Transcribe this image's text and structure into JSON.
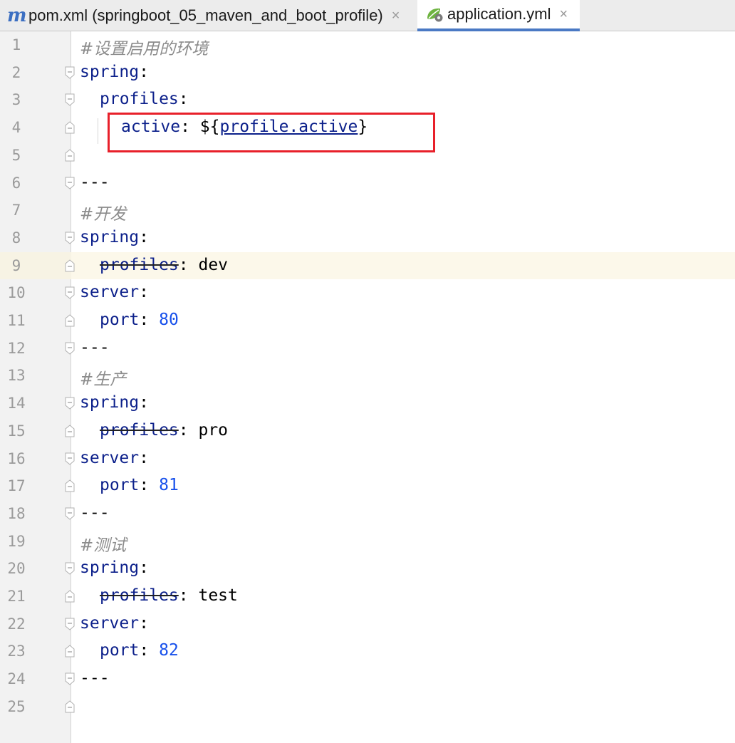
{
  "tabs": [
    {
      "label": "pom.xml (springboot_05_maven_and_boot_profile)",
      "icon": "maven-m-icon",
      "active": false
    },
    {
      "label": "application.yml",
      "icon": "spring-yml-icon",
      "active": true
    }
  ],
  "tab_close_glyph": "×",
  "editor": {
    "current_line": 9,
    "lines": [
      {
        "n": "1",
        "type": "comment",
        "indent": 0,
        "text": "#设置启用的环境"
      },
      {
        "n": "2",
        "type": "key",
        "indent": 0,
        "key": "spring",
        "colon": ":"
      },
      {
        "n": "3",
        "type": "key",
        "indent": 1,
        "key": "profiles",
        "colon": ":"
      },
      {
        "n": "4",
        "type": "ref",
        "indent": 2,
        "key": "active",
        "colon": ": ",
        "pre": "${",
        "ref": "profile.active",
        "post": "}"
      },
      {
        "n": "5",
        "type": "empty"
      },
      {
        "n": "6",
        "type": "sep",
        "text": "---"
      },
      {
        "n": "7",
        "type": "comment",
        "indent": 0,
        "text": "#开发"
      },
      {
        "n": "8",
        "type": "key",
        "indent": 0,
        "key": "spring",
        "colon": ":"
      },
      {
        "n": "9",
        "type": "dep",
        "indent": 1,
        "key": "profiles",
        "colon": ": ",
        "value": "dev"
      },
      {
        "n": "10",
        "type": "key",
        "indent": 0,
        "key": "server",
        "colon": ":"
      },
      {
        "n": "11",
        "type": "num",
        "indent": 1,
        "key": "port",
        "colon": ": ",
        "value": "80"
      },
      {
        "n": "12",
        "type": "sep",
        "text": "---"
      },
      {
        "n": "13",
        "type": "comment",
        "indent": 0,
        "text": "#生产"
      },
      {
        "n": "14",
        "type": "key",
        "indent": 0,
        "key": "spring",
        "colon": ":"
      },
      {
        "n": "15",
        "type": "dep",
        "indent": 1,
        "key": "profiles",
        "colon": ": ",
        "value": "pro"
      },
      {
        "n": "16",
        "type": "key",
        "indent": 0,
        "key": "server",
        "colon": ":"
      },
      {
        "n": "17",
        "type": "num",
        "indent": 1,
        "key": "port",
        "colon": ": ",
        "value": "81"
      },
      {
        "n": "18",
        "type": "sep",
        "text": "---"
      },
      {
        "n": "19",
        "type": "comment",
        "indent": 0,
        "text": "#测试"
      },
      {
        "n": "20",
        "type": "key",
        "indent": 0,
        "key": "spring",
        "colon": ":"
      },
      {
        "n": "21",
        "type": "dep",
        "indent": 1,
        "key": "profiles",
        "colon": ": ",
        "value": "test"
      },
      {
        "n": "22",
        "type": "key",
        "indent": 0,
        "key": "server",
        "colon": ":"
      },
      {
        "n": "23",
        "type": "num",
        "indent": 1,
        "key": "port",
        "colon": ": ",
        "value": "82"
      },
      {
        "n": "24",
        "type": "sep",
        "text": "---"
      },
      {
        "n": "25",
        "type": "empty"
      }
    ]
  },
  "colors": {
    "key": "#0b1f8a",
    "number": "#1750eb",
    "comment": "#8c8c8c",
    "highlight_box": "#e8202a",
    "active_tab_underline": "#4a79c4"
  }
}
